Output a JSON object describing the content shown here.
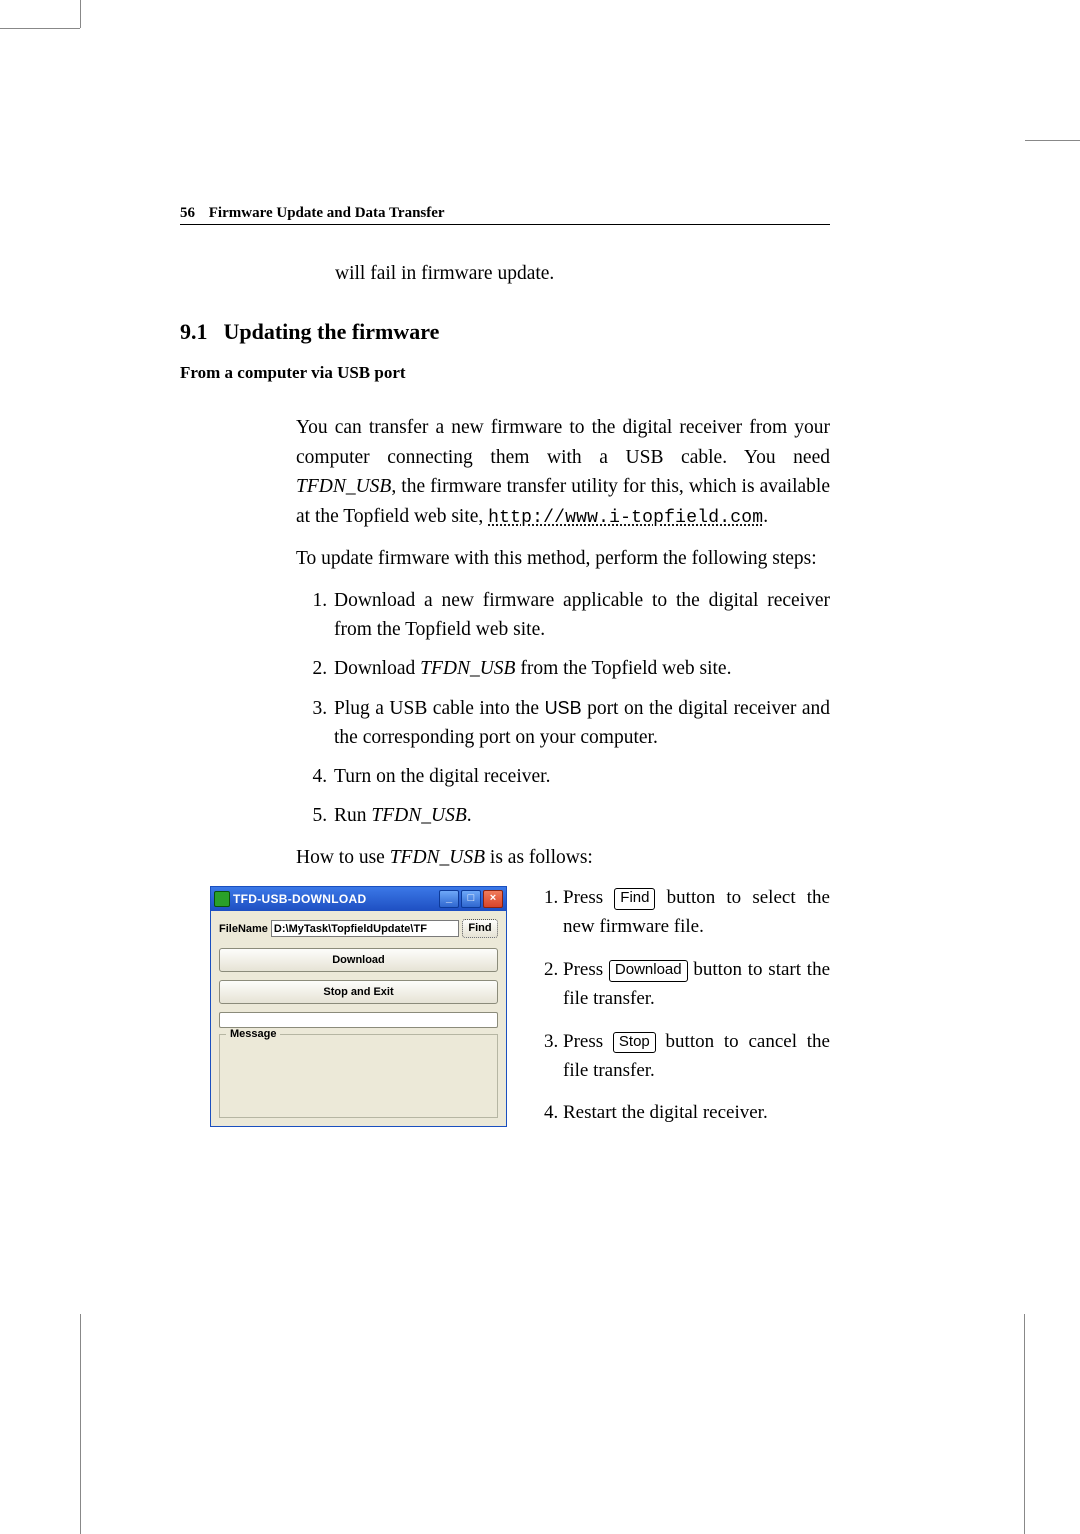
{
  "running_head": {
    "page": "56",
    "title": "Firmware Update and Data Transfer"
  },
  "fragment": "will fail in firmware update.",
  "section": {
    "number": "9.1",
    "title": "Updating the firmware"
  },
  "subsection": "From a computer via USB port",
  "para1_a": "You can transfer a new firmware to the digital receiver from your computer connecting them with a USB cable. You need ",
  "para1_app": "TFDN_USB",
  "para1_b": ", the firmware transfer utility for this, which is available at the Topfield web site, ",
  "para1_url": "http://www.i-topfield.com",
  "para1_c": ".",
  "para2": "To update firmware with this method, perform the following steps:",
  "steps": [
    "Download a new firmware applicable to the digital receiver from the Topfield web site.",
    "Download TFDN_USB from the Topfield web site.",
    "Plug a USB cable into the USB port on the digital receiver and the corresponding port on your computer.",
    "Turn on the digital receiver.",
    "Run TFDN_USB."
  ],
  "howto_a": "How to use ",
  "howto_app": "TFDN_USB",
  "howto_b": " is as follows:",
  "right_steps": {
    "s1a": "Press ",
    "s1btn": "Find",
    "s1b": " button to select the new firmware file.",
    "s2a": "Press ",
    "s2btn": "Download",
    "s2b": " button to start the file transfer.",
    "s3a": "Press ",
    "s3btn": "Stop",
    "s3b": " button to cancel the file transfer.",
    "s4": "Restart the digital receiver."
  },
  "app_window": {
    "title": "TFD-USB-DOWNLOAD",
    "filename_label": "FileName",
    "filename_value": "D:\\MyTask\\TopfieldUpdate\\TF",
    "find_btn": "Find",
    "download_btn": "Download",
    "stop_btn": "Stop and Exit",
    "message_label": "Message"
  }
}
